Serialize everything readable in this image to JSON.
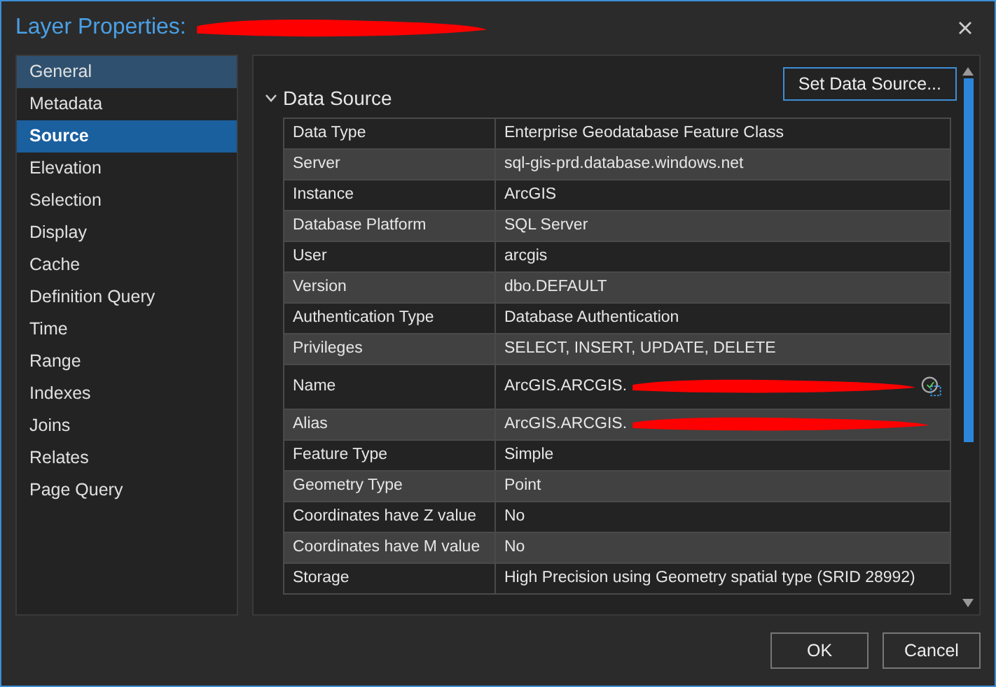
{
  "window": {
    "title": "Layer Properties:"
  },
  "sidebar": {
    "items": [
      {
        "label": "General",
        "selected": false,
        "hovered": true
      },
      {
        "label": "Metadata",
        "selected": false,
        "hovered": false
      },
      {
        "label": "Source",
        "selected": true,
        "hovered": false
      },
      {
        "label": "Elevation",
        "selected": false,
        "hovered": false
      },
      {
        "label": "Selection",
        "selected": false,
        "hovered": false
      },
      {
        "label": "Display",
        "selected": false,
        "hovered": false
      },
      {
        "label": "Cache",
        "selected": false,
        "hovered": false
      },
      {
        "label": "Definition Query",
        "selected": false,
        "hovered": false
      },
      {
        "label": "Time",
        "selected": false,
        "hovered": false
      },
      {
        "label": "Range",
        "selected": false,
        "hovered": false
      },
      {
        "label": "Indexes",
        "selected": false,
        "hovered": false
      },
      {
        "label": "Joins",
        "selected": false,
        "hovered": false
      },
      {
        "label": "Relates",
        "selected": false,
        "hovered": false
      },
      {
        "label": "Page Query",
        "selected": false,
        "hovered": false
      }
    ]
  },
  "section": {
    "title": "Data Source",
    "expanded": true,
    "button": "Set Data Source...",
    "rows": [
      {
        "property": "Data Type",
        "value": "Enterprise Geodatabase Feature Class"
      },
      {
        "property": "Server",
        "value": "sql-gis-prd.database.windows.net"
      },
      {
        "property": "Instance",
        "value": "ArcGIS"
      },
      {
        "property": "Database Platform",
        "value": "SQL Server"
      },
      {
        "property": "User",
        "value": "arcgis"
      },
      {
        "property": "Version",
        "value": "dbo.DEFAULT"
      },
      {
        "property": "Authentication Type",
        "value": "Database Authentication"
      },
      {
        "property": "Privileges",
        "value": "SELECT, INSERT, UPDATE, DELETE"
      },
      {
        "property": "Name",
        "value": "ArcGIS.ARCGIS.",
        "redacted": true,
        "kind": "copyable"
      },
      {
        "property": "Alias",
        "value": "ArcGIS.ARCGIS.",
        "redacted": true
      },
      {
        "property": "Feature Type",
        "value": "Simple"
      },
      {
        "property": "Geometry Type",
        "value": "Point"
      },
      {
        "property": "Coordinates have Z value",
        "value": "No"
      },
      {
        "property": "Coordinates have M value",
        "value": "No"
      },
      {
        "property": "Storage",
        "value": "High Precision using Geometry spatial type (SRID 28992)"
      }
    ]
  },
  "buttons": [
    "OK",
    "Cancel"
  ]
}
